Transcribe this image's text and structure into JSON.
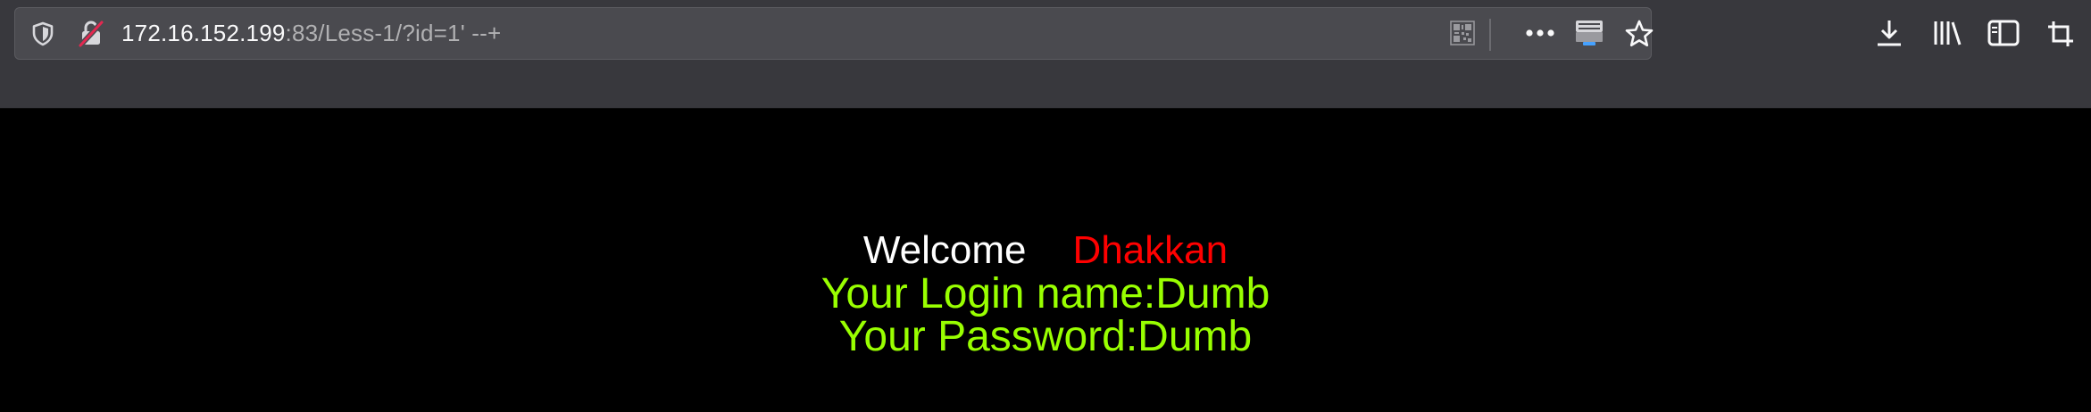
{
  "browser": {
    "url_host": "172.16.152.199",
    "url_rest": ":83/Less-1/?id=1' --+",
    "icons": {
      "tracking_protection": "shield-icon",
      "insecure_connection": "insecure-lock-icon",
      "qr_code": "qr-code-icon",
      "page_actions": "more-horizontal-icon",
      "pocket": "save-to-pocket-icon",
      "bookmark": "star-icon",
      "downloads": "download-icon",
      "library": "library-icon",
      "sidebar": "sidebar-icon",
      "screenshot": "screenshot-crop-icon"
    },
    "colors": {
      "toolbar": "#38383d",
      "urlbar": "#4a4a4f",
      "insecure_slash": "#e22850"
    }
  },
  "page": {
    "welcome": "Welcome",
    "username": "Dhakkan",
    "login_line": "Your Login name:Dumb",
    "password_line": "Your Password:Dumb",
    "colors": {
      "background": "#000000",
      "welcome": "#ffffff",
      "username": "#ff0000",
      "info": "#99ff00"
    }
  }
}
